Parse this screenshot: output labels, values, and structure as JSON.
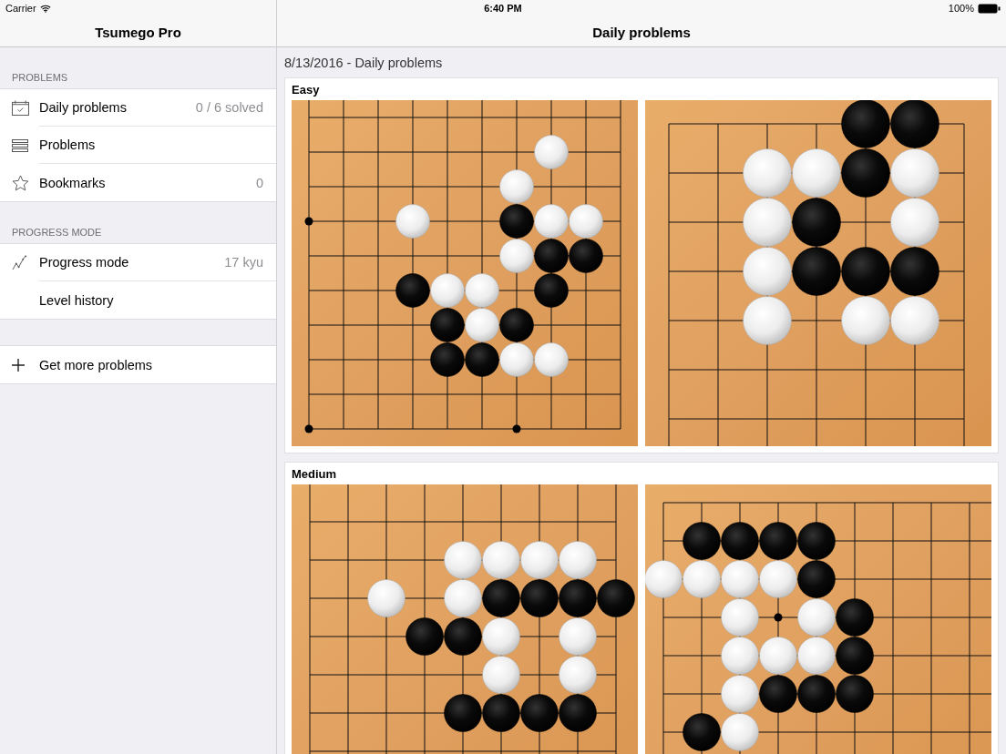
{
  "status_bar": {
    "carrier": "Carrier",
    "time": "6:40 PM",
    "battery": "100%"
  },
  "sidebar": {
    "title": "Tsumego Pro",
    "sections": [
      {
        "header": "PROBLEMS",
        "items": [
          {
            "kind": "calendar",
            "label": "Daily problems",
            "detail": "0 / 6 solved"
          },
          {
            "kind": "list",
            "label": "Problems"
          },
          {
            "kind": "star",
            "label": "Bookmarks",
            "detail": "0"
          }
        ]
      },
      {
        "header": "PROGRESS MODE",
        "items": [
          {
            "kind": "graph",
            "label": "Progress mode",
            "detail": "17 kyu"
          },
          {
            "kind": "plain",
            "label": "Level history"
          }
        ]
      }
    ],
    "action": {
      "label": "Get more problems"
    }
  },
  "content": {
    "title": "Daily problems",
    "date_heading": "8/13/2016 - Daily problems",
    "groups": [
      {
        "title": "Easy"
      },
      {
        "title": "Medium"
      }
    ]
  }
}
